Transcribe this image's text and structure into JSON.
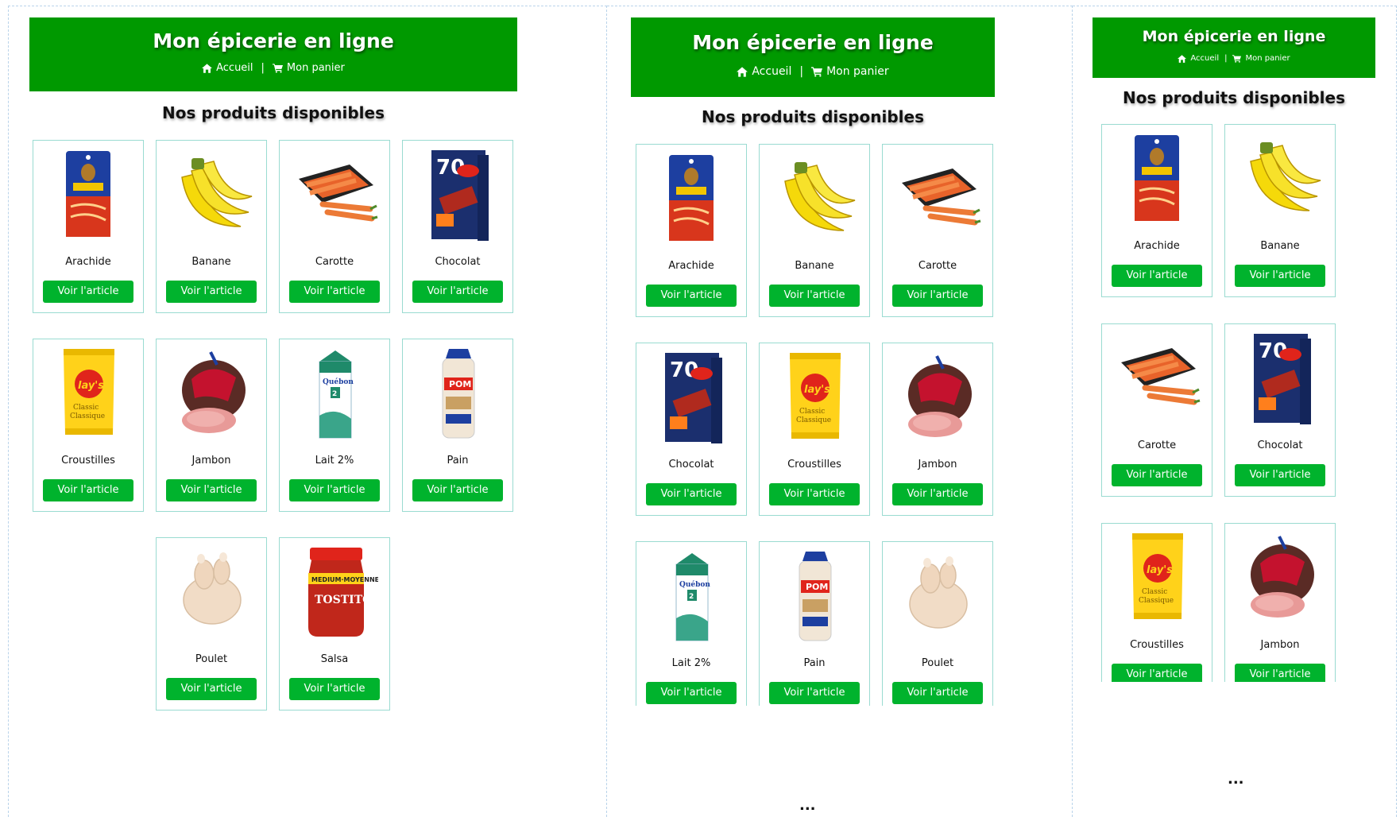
{
  "site": {
    "title": "Mon épicerie en ligne",
    "nav_home": "Accueil",
    "nav_separator": "|",
    "nav_cart": "Mon panier",
    "section_title": "Nos produits disponibles",
    "button_label": "Voir l'article",
    "ellipsis": "..."
  },
  "products": [
    {
      "name": "Arachide",
      "icon": "peanut-bag-image"
    },
    {
      "name": "Banane",
      "icon": "banana-image"
    },
    {
      "name": "Carotte",
      "icon": "carrot-image"
    },
    {
      "name": "Chocolat",
      "icon": "chocolate-box-image"
    },
    {
      "name": "Croustilles",
      "icon": "chips-bag-image"
    },
    {
      "name": "Jambon",
      "icon": "ham-image"
    },
    {
      "name": "Lait 2%",
      "icon": "milk-carton-image"
    },
    {
      "name": "Pain",
      "icon": "bread-image"
    },
    {
      "name": "Poulet",
      "icon": "chicken-image"
    },
    {
      "name": "Salsa",
      "icon": "salsa-jar-image"
    }
  ],
  "colors": {
    "header_green": "#009900",
    "button_green": "#00b32d",
    "card_border": "#9adbd1"
  }
}
